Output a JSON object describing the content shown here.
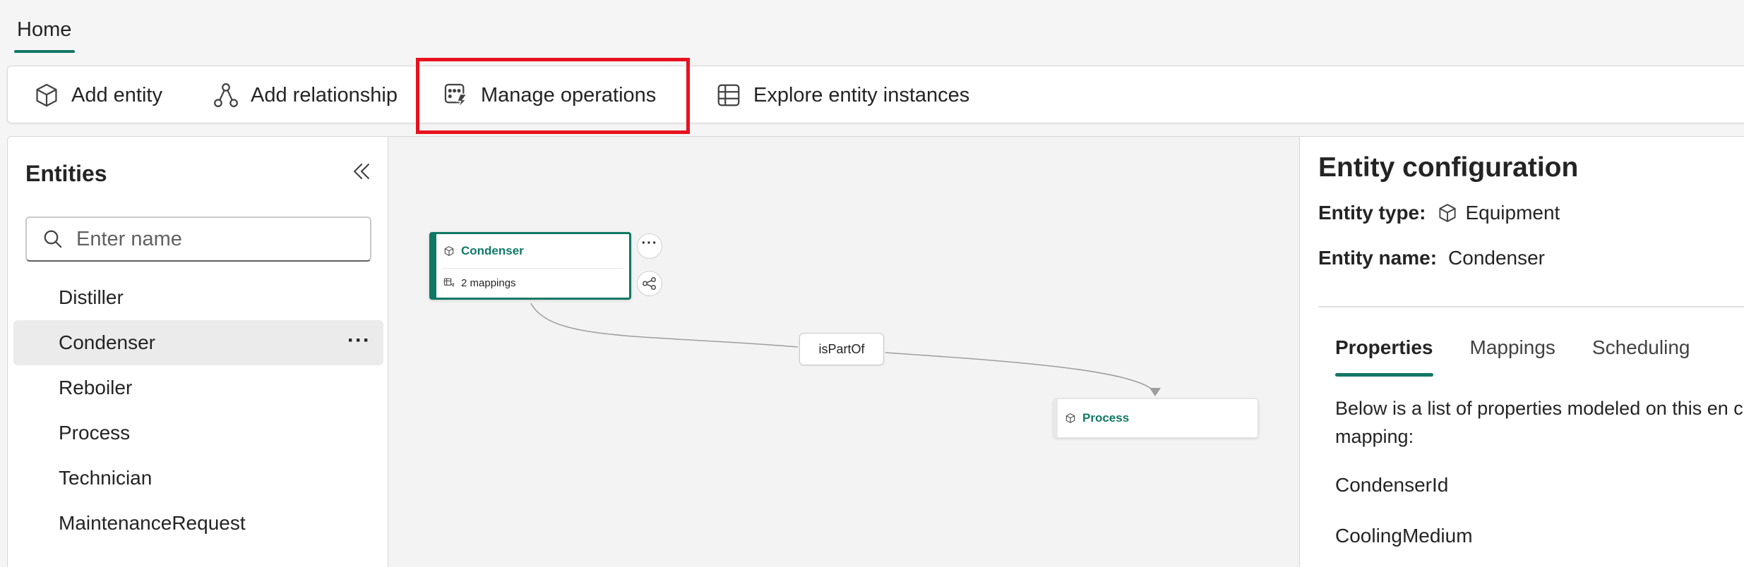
{
  "tabs": {
    "home": "Home"
  },
  "toolbar": {
    "add_entity": "Add entity",
    "add_relationship": "Add relationship",
    "manage_operations": "Manage operations",
    "explore_instances": "Explore entity instances"
  },
  "entities_panel": {
    "title": "Entities",
    "search_placeholder": "Enter name",
    "items": [
      {
        "label": "Distiller"
      },
      {
        "label": "Condenser",
        "more": "···"
      },
      {
        "label": "Reboiler"
      },
      {
        "label": "Process"
      },
      {
        "label": "Technician"
      },
      {
        "label": "MaintenanceRequest"
      }
    ]
  },
  "canvas": {
    "nodes": {
      "condenser": {
        "title": "Condenser",
        "subtitle": "2 mappings"
      },
      "process": {
        "title": "Process"
      }
    },
    "node_more": "···",
    "edge_label": "isPartOf"
  },
  "config": {
    "title": "Entity configuration",
    "type_label": "Entity type:",
    "type_value": "Equipment",
    "name_label": "Entity name:",
    "name_value": "Condenser",
    "tabs": [
      "Properties",
      "Mappings",
      "Scheduling"
    ],
    "description": "Below is a list of properties modeled on this en create a mapping:",
    "properties": [
      "CondenserId",
      "CoolingMedium"
    ]
  },
  "colors": {
    "accent": "#117865",
    "highlight": "#e8121f"
  }
}
